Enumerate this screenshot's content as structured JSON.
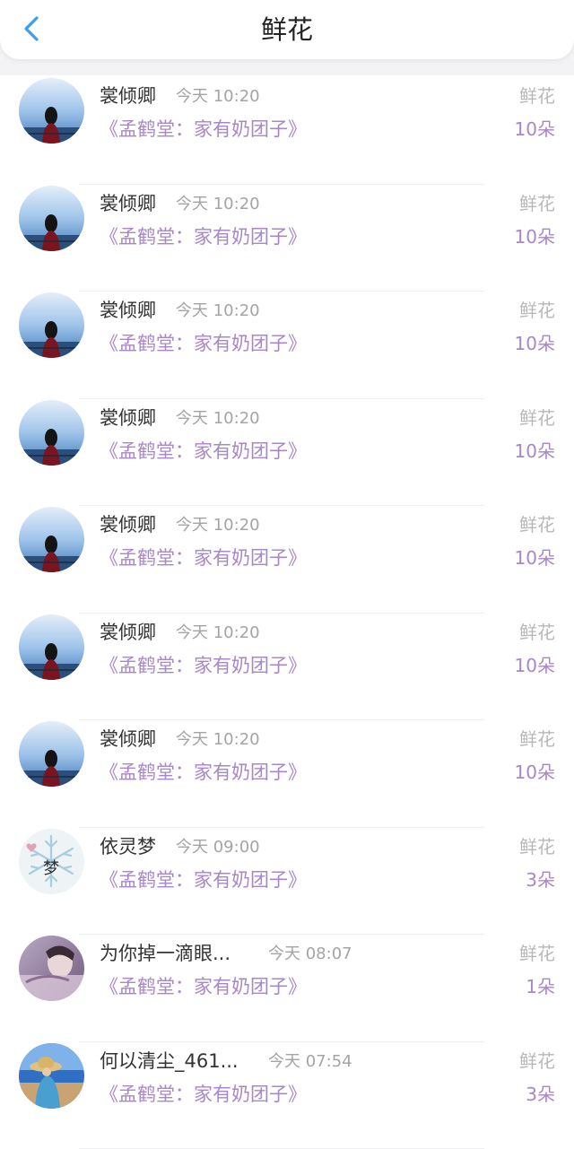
{
  "header": {
    "title": "鲜花",
    "back_icon": "chevron-left-icon"
  },
  "records": [
    {
      "name": "裳倾卿",
      "time": "今天 10:20",
      "book": "《孟鹤堂：家有奶团子》",
      "gift": "鲜花",
      "count": "10朵",
      "avatar": "sea-girl"
    },
    {
      "name": "裳倾卿",
      "time": "今天 10:20",
      "book": "《孟鹤堂：家有奶团子》",
      "gift": "鲜花",
      "count": "10朵",
      "avatar": "sea-girl"
    },
    {
      "name": "裳倾卿",
      "time": "今天 10:20",
      "book": "《孟鹤堂：家有奶团子》",
      "gift": "鲜花",
      "count": "10朵",
      "avatar": "sea-girl"
    },
    {
      "name": "裳倾卿",
      "time": "今天 10:20",
      "book": "《孟鹤堂：家有奶团子》",
      "gift": "鲜花",
      "count": "10朵",
      "avatar": "sea-girl"
    },
    {
      "name": "裳倾卿",
      "time": "今天 10:20",
      "book": "《孟鹤堂：家有奶团子》",
      "gift": "鲜花",
      "count": "10朵",
      "avatar": "sea-girl"
    },
    {
      "name": "裳倾卿",
      "time": "今天 10:20",
      "book": "《孟鹤堂：家有奶团子》",
      "gift": "鲜花",
      "count": "10朵",
      "avatar": "sea-girl"
    },
    {
      "name": "裳倾卿",
      "time": "今天 10:20",
      "book": "《孟鹤堂：家有奶团子》",
      "gift": "鲜花",
      "count": "10朵",
      "avatar": "sea-girl"
    },
    {
      "name": "依灵梦",
      "time": "今天 09:00",
      "book": "《孟鹤堂：家有奶团子》",
      "gift": "鲜花",
      "count": "3朵",
      "avatar": "dream-snowflake",
      "avatar_text": "梦"
    },
    {
      "name": "为你掉一滴眼...",
      "time": "今天 08:07",
      "book": "《孟鹤堂：家有奶团子》",
      "gift": "鲜花",
      "count": "1朵",
      "avatar": "purple-portrait"
    },
    {
      "name": "何以清尘_461...",
      "time": "今天 07:54",
      "book": "《孟鹤堂：家有奶团子》",
      "gift": "鲜花",
      "count": "3朵",
      "avatar": "beach-hat"
    }
  ],
  "colors": {
    "accent": "#a787c9",
    "back": "#3d9bf0"
  }
}
